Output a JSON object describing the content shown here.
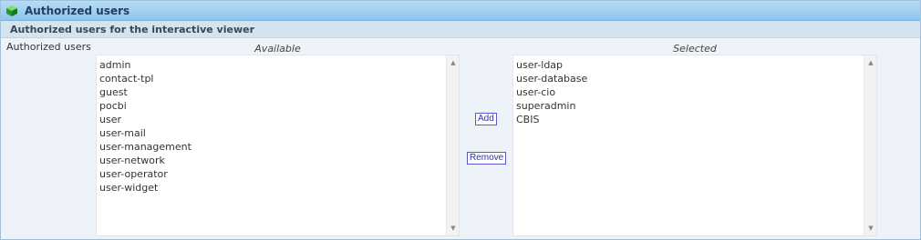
{
  "panel": {
    "title": "Authorized users",
    "subtitle": "Authorized users for the interactive viewer"
  },
  "form": {
    "row_label": "Authorized users",
    "available_label": "Available",
    "selected_label": "Selected",
    "available_items": [
      "admin",
      "contact-tpl",
      "guest",
      "pocbi",
      "user",
      "user-mail",
      "user-management",
      "user-network",
      "user-operator",
      "user-widget"
    ],
    "selected_items": [
      "user-ldap",
      "user-database",
      "user-cio",
      "superadmin",
      "CBIS"
    ],
    "add_label": "Add",
    "remove_label": "Remove"
  },
  "icons": {
    "header": "green-cube-icon",
    "scroll_up": "triangle-up-icon",
    "scroll_down": "triangle-down-icon"
  },
  "colors": {
    "header_bg": "#8ec6ec",
    "subheader_bg": "#d4e3ef",
    "content_bg": "#eef3f9",
    "button_border": "#5b5bcf"
  }
}
